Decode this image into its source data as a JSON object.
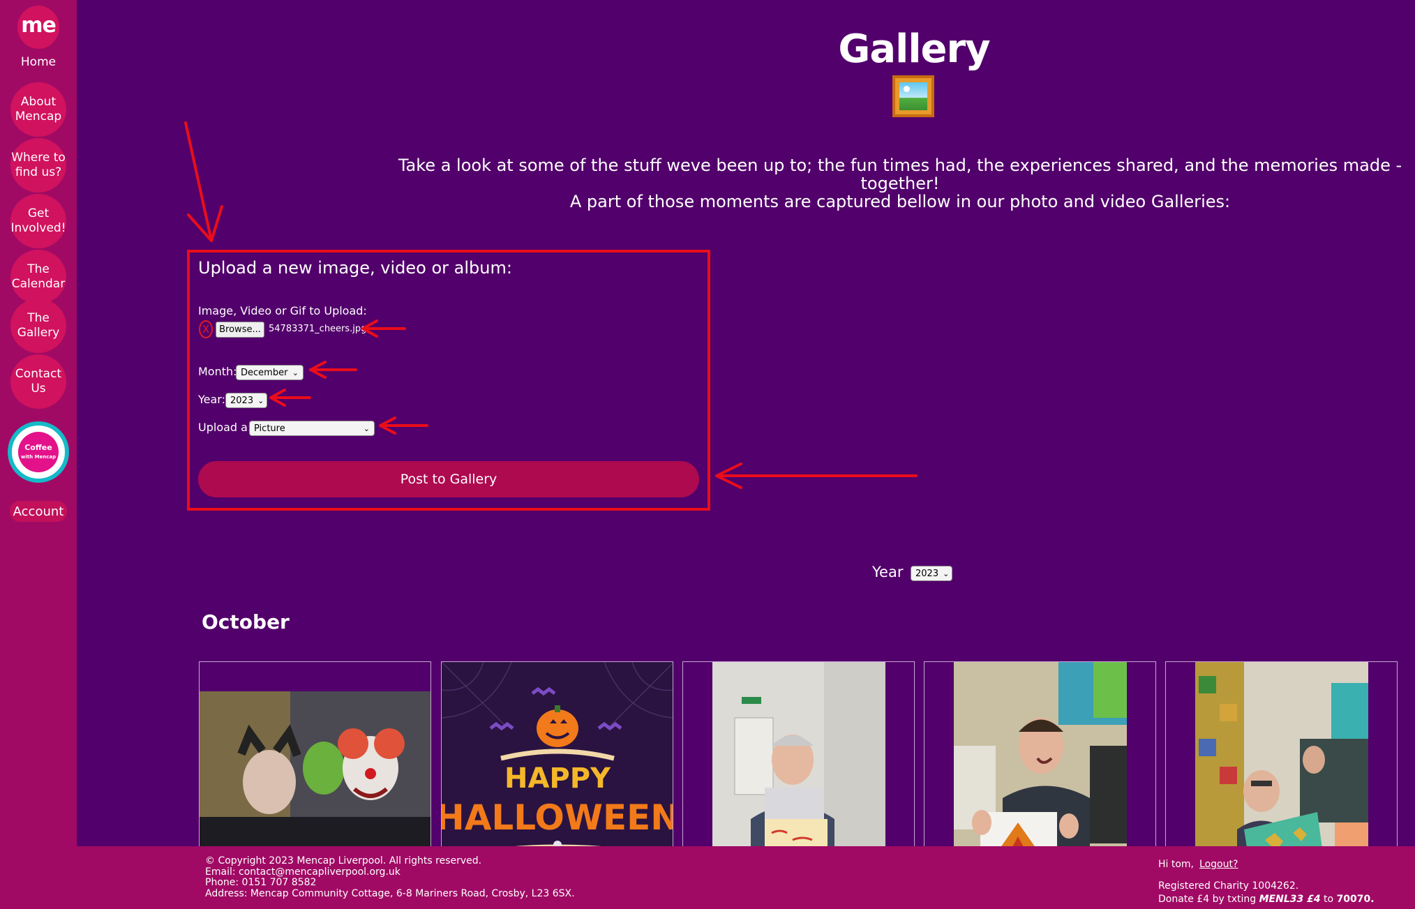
{
  "sidebar": {
    "logo_text": "me",
    "home_label": "Home",
    "items": [
      {
        "label": "About Mencap"
      },
      {
        "label": "Where to find us?"
      },
      {
        "label": "Get Involved!"
      },
      {
        "label": "The Calendar"
      },
      {
        "label": "The Gallery"
      },
      {
        "label": "Contact Us"
      }
    ],
    "coffee_badge": "Coffee",
    "coffee_badge_sub": "with Mencap",
    "account_label": "Account"
  },
  "header": {
    "title": "Gallery",
    "icon": "framed-picture-icon",
    "intro_line1": "Take a look at some of the stuff weve been up to; the fun times had, the experiences shared, and the memories made - together!",
    "intro_line2": "A part of those moments are captured bellow in our photo and video Galleries:"
  },
  "upload_form": {
    "title": "Upload a new image, video or album:",
    "file_label": "Image, Video or Gif to Upload:",
    "clear_label": "X",
    "browse_label": "Browse...",
    "file_name": "54783371_cheers.jpg",
    "month_label": "Month:",
    "month_value": "December",
    "year_label": "Year:",
    "year_value": "2023",
    "type_label": "Upload a:",
    "type_value": "Picture",
    "submit_label": "Post to Gallery"
  },
  "filter": {
    "year_label": "Year",
    "year_value": "2023"
  },
  "gallery": {
    "month_heading": "October",
    "tiles": [
      {
        "name": "halloween-costumes-photo"
      },
      {
        "name": "happy-halloween-graphic",
        "line1": "HAPPY",
        "line2": "HALLOWEEN"
      },
      {
        "name": "man-holding-artwork-photo"
      },
      {
        "name": "man-with-leaf-painting-photo"
      },
      {
        "name": "craft-room-photo"
      }
    ]
  },
  "footer": {
    "copyright": "© Copyright 2023 Mencap Liverpool. All rights reserved.",
    "email": "Email:  contact@mencapliverpool.org.uk",
    "phone": "Phone:  0151 707 8582",
    "address": "Address:  Mencap Community Cottage, 6-8 Mariners Road, Crosby, L23 6SX.",
    "greeting": "Hi tom,",
    "logout_label": "Logout?",
    "charity": "Registered Charity 1004262.",
    "donate_prefix": "Donate £4 by txting",
    "donate_code": "MENL33 £4",
    "donate_mid": "to",
    "donate_number": "70070."
  },
  "colors": {
    "background": "#52006b",
    "sidebar": "#a00a64",
    "nav_bubble": "#d1125f",
    "button": "#ae0a50",
    "annotation_red": "#ea0d1a"
  }
}
